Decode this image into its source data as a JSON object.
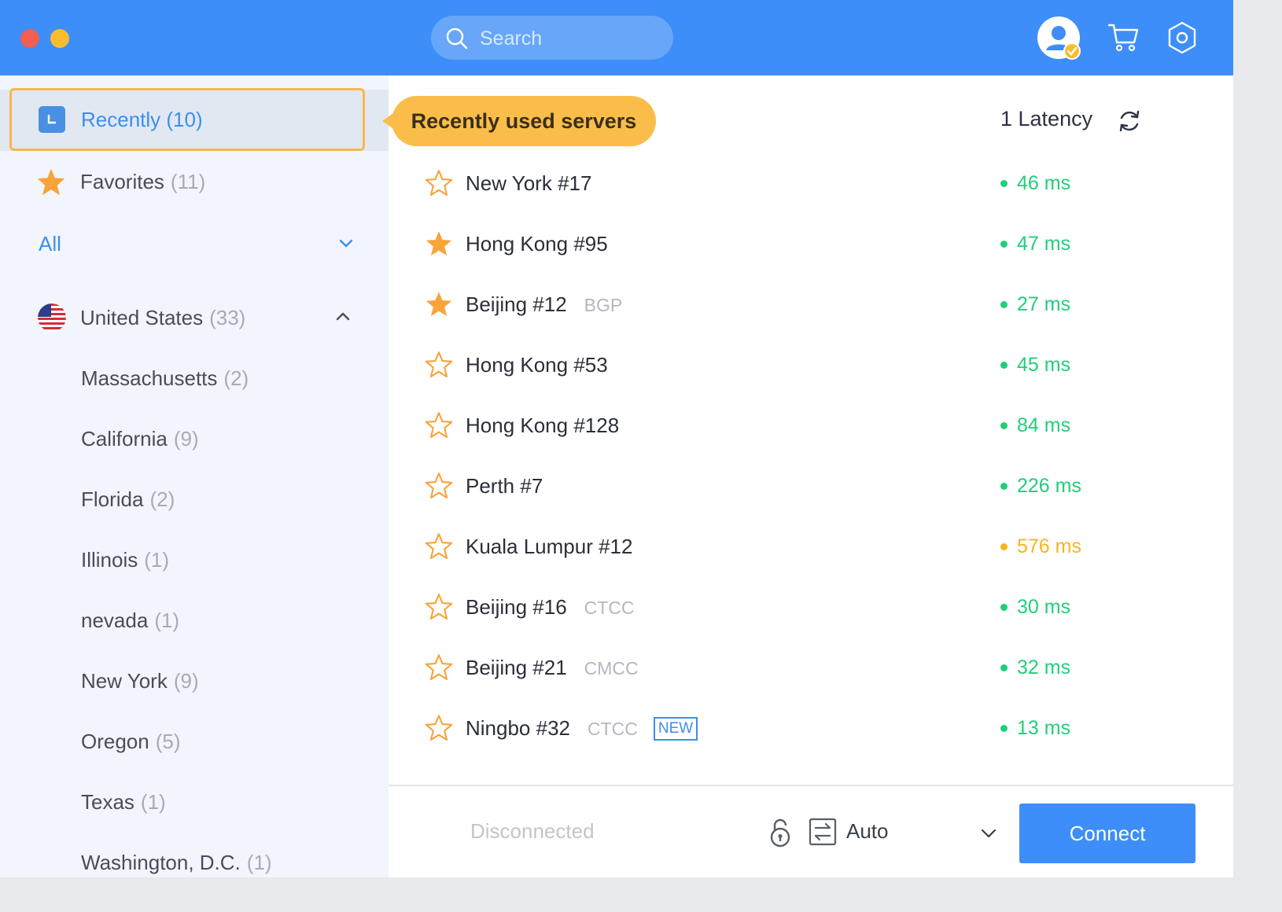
{
  "search": {
    "placeholder": "Search"
  },
  "sidebar": {
    "recently": {
      "label": "Recently (10)"
    },
    "favorites": {
      "label": "Favorites",
      "count": "(11)"
    },
    "filter": {
      "label": "All"
    },
    "country": {
      "label": "United States",
      "count": "(33)"
    },
    "states": [
      {
        "label": "Massachusetts",
        "count": "(2)"
      },
      {
        "label": "California",
        "count": "(9)"
      },
      {
        "label": "Florida",
        "count": "(2)"
      },
      {
        "label": "Illinois",
        "count": "(1)"
      },
      {
        "label": "nevada",
        "count": "(1)"
      },
      {
        "label": "New York",
        "count": "(9)"
      },
      {
        "label": "Oregon",
        "count": "(5)"
      },
      {
        "label": "Texas",
        "count": "(1)"
      },
      {
        "label": "Washington, D.C.",
        "count": "(1)"
      }
    ]
  },
  "main": {
    "tooltip": "Recently used servers",
    "latency_header": "1 Latency",
    "servers": [
      {
        "name": "New York #17",
        "tag": "",
        "badge": "",
        "favorite": false,
        "latency": "46 ms",
        "status": "good"
      },
      {
        "name": "Hong Kong #95",
        "tag": "",
        "badge": "",
        "favorite": true,
        "latency": "47 ms",
        "status": "good"
      },
      {
        "name": "Beijing #12",
        "tag": "BGP",
        "badge": "",
        "favorite": true,
        "latency": "27 ms",
        "status": "good"
      },
      {
        "name": "Hong Kong #53",
        "tag": "",
        "badge": "",
        "favorite": false,
        "latency": "45 ms",
        "status": "good"
      },
      {
        "name": "Hong Kong #128",
        "tag": "",
        "badge": "",
        "favorite": false,
        "latency": "84 ms",
        "status": "good"
      },
      {
        "name": "Perth #7",
        "tag": "",
        "badge": "",
        "favorite": false,
        "latency": "226 ms",
        "status": "good"
      },
      {
        "name": "Kuala Lumpur #12",
        "tag": "",
        "badge": "",
        "favorite": false,
        "latency": "576 ms",
        "status": "slow"
      },
      {
        "name": "Beijing #16",
        "tag": "CTCC",
        "badge": "",
        "favorite": false,
        "latency": "30 ms",
        "status": "good"
      },
      {
        "name": "Beijing #21",
        "tag": "CMCC",
        "badge": "",
        "favorite": false,
        "latency": "32 ms",
        "status": "good"
      },
      {
        "name": "Ningbo #32",
        "tag": "CTCC",
        "badge": "NEW",
        "favorite": false,
        "latency": "13 ms",
        "status": "good"
      }
    ]
  },
  "footer": {
    "status": "Disconnected",
    "protocol": "Auto",
    "connect_label": "Connect"
  },
  "colors": {
    "accent": "#3d8ef8",
    "favorite": "#f8a43a",
    "latency_good": "#1fcf7a",
    "latency_slow": "#f9b51c",
    "highlight": "#fbbd4a"
  }
}
